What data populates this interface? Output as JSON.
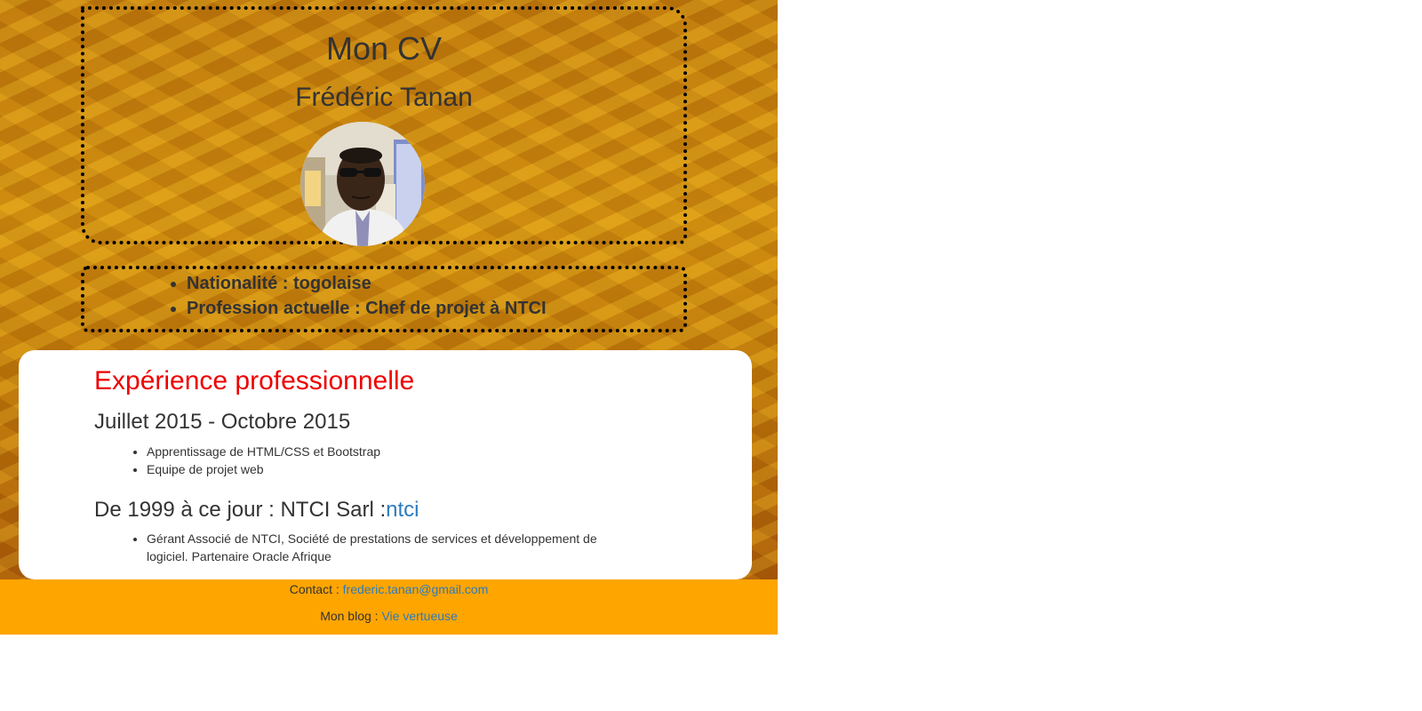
{
  "header": {
    "title": "Mon CV",
    "name": "Frédéric Tanan",
    "photo_alt": "Photo de Frédéric Tanan"
  },
  "info": {
    "items": [
      "Nationalité : togolaise",
      "Profession actuelle : Chef de projet à NTCI"
    ]
  },
  "experience": {
    "section_title": "Expérience professionnelle",
    "jobs": [
      {
        "title": "Juillet 2015 - Octobre 2015",
        "link": "",
        "bullets": [
          "Apprentissage de HTML/CSS et Bootstrap",
          "Equipe de projet web"
        ]
      },
      {
        "title": "De 1999 à ce jour : NTCI Sarl :",
        "link": "ntci",
        "bullets": [
          "Gérant Associé de NTCI, Société de prestations de services et développement de logiciel. Partenaire Oracle Afrique"
        ]
      }
    ]
  },
  "footer": {
    "contact_label": "Contact : ",
    "contact_email": "frederic.tanan@gmail.com",
    "blog_label": "Mon blog : ",
    "blog_link": "Vie vertueuse"
  },
  "colors": {
    "section_title": "#ee0000",
    "link": "#2a7bbf",
    "footer_bg": "#ffa500",
    "text": "#333333"
  },
  "icons": {
    "list_bullet": "disc"
  }
}
